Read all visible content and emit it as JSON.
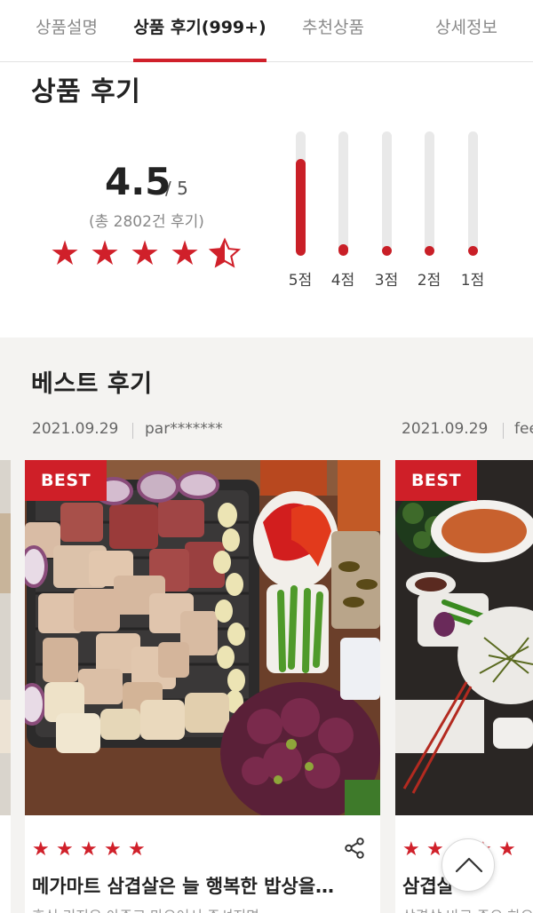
{
  "tabs": [
    {
      "label": "상품설명"
    },
    {
      "label": "상품 후기(999+)"
    },
    {
      "label": "추천상품"
    },
    {
      "label": "상세정보"
    }
  ],
  "summary": {
    "title": "상품 후기",
    "score": "4.5",
    "score_total": "/ 5",
    "review_count": "(총 2802건 후기)",
    "rating": 4.5,
    "distribution": [
      {
        "label": "5점",
        "fraction": 0.78
      },
      {
        "label": "4점",
        "fraction": 0.09
      },
      {
        "label": "3점",
        "fraction": 0.05
      },
      {
        "label": "2점",
        "fraction": 0.04
      },
      {
        "label": "1점",
        "fraction": 0.05
      }
    ]
  },
  "best": {
    "title": "베스트 후기",
    "reviews": [
      {
        "date": "2021.09.29",
        "user": "par*******",
        "badge": "BEST",
        "rating": 5,
        "title": "메가마트 삼겹살은 늘 행복한 밥상을…",
        "snippet": "후식 리지유 아주고 마으어서 주셔지면"
      },
      {
        "date": "2021.09.29",
        "user": "fee",
        "badge": "BEST",
        "rating": 5,
        "title": "삼겹살",
        "snippet": "삼겹살 바로 주으 하오"
      }
    ]
  },
  "icons": {
    "share": "share-icon",
    "scroll_top": "chevron-up-icon",
    "star": "star-icon"
  },
  "colors": {
    "accent": "#d0202a",
    "background_section": "#f4f3f1"
  }
}
